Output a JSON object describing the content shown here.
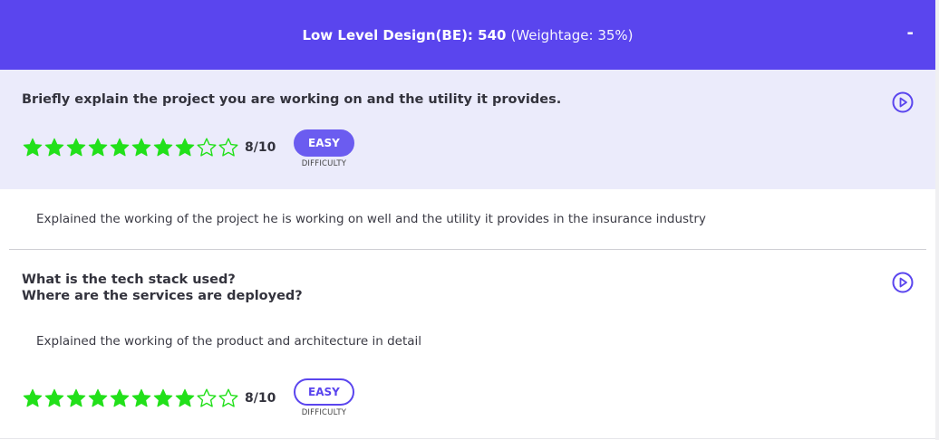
{
  "header": {
    "title": "Low Level Design(BE): 540",
    "weightage": "(Weightage: 35%)",
    "collapse_label": "-"
  },
  "colors": {
    "header_bg": "#5a45ee",
    "highlight_bg": "#ebebfb",
    "star_color": "#22e01a",
    "pill_color": "#6b5cf0"
  },
  "questions": [
    {
      "text": "Briefly explain the project you are working on and the utility it provides.",
      "rating": 8,
      "rating_max": 10,
      "score_label": "8/10",
      "difficulty": "EASY",
      "difficulty_label": "DIFFICULTY",
      "answer": "Explained the working of the project he is working on well and the utility it provides in the insurance industry",
      "play_icon": "play-circle-icon"
    },
    {
      "text_line1": "What is the tech stack used?",
      "text_line2": "Where are the services are deployed?",
      "rating": 8,
      "rating_max": 10,
      "score_label": "8/10",
      "difficulty": "EASY",
      "difficulty_label": "DIFFICULTY",
      "answer": "Explained the working of the product and architecture in detail",
      "play_icon": "play-circle-icon"
    }
  ]
}
